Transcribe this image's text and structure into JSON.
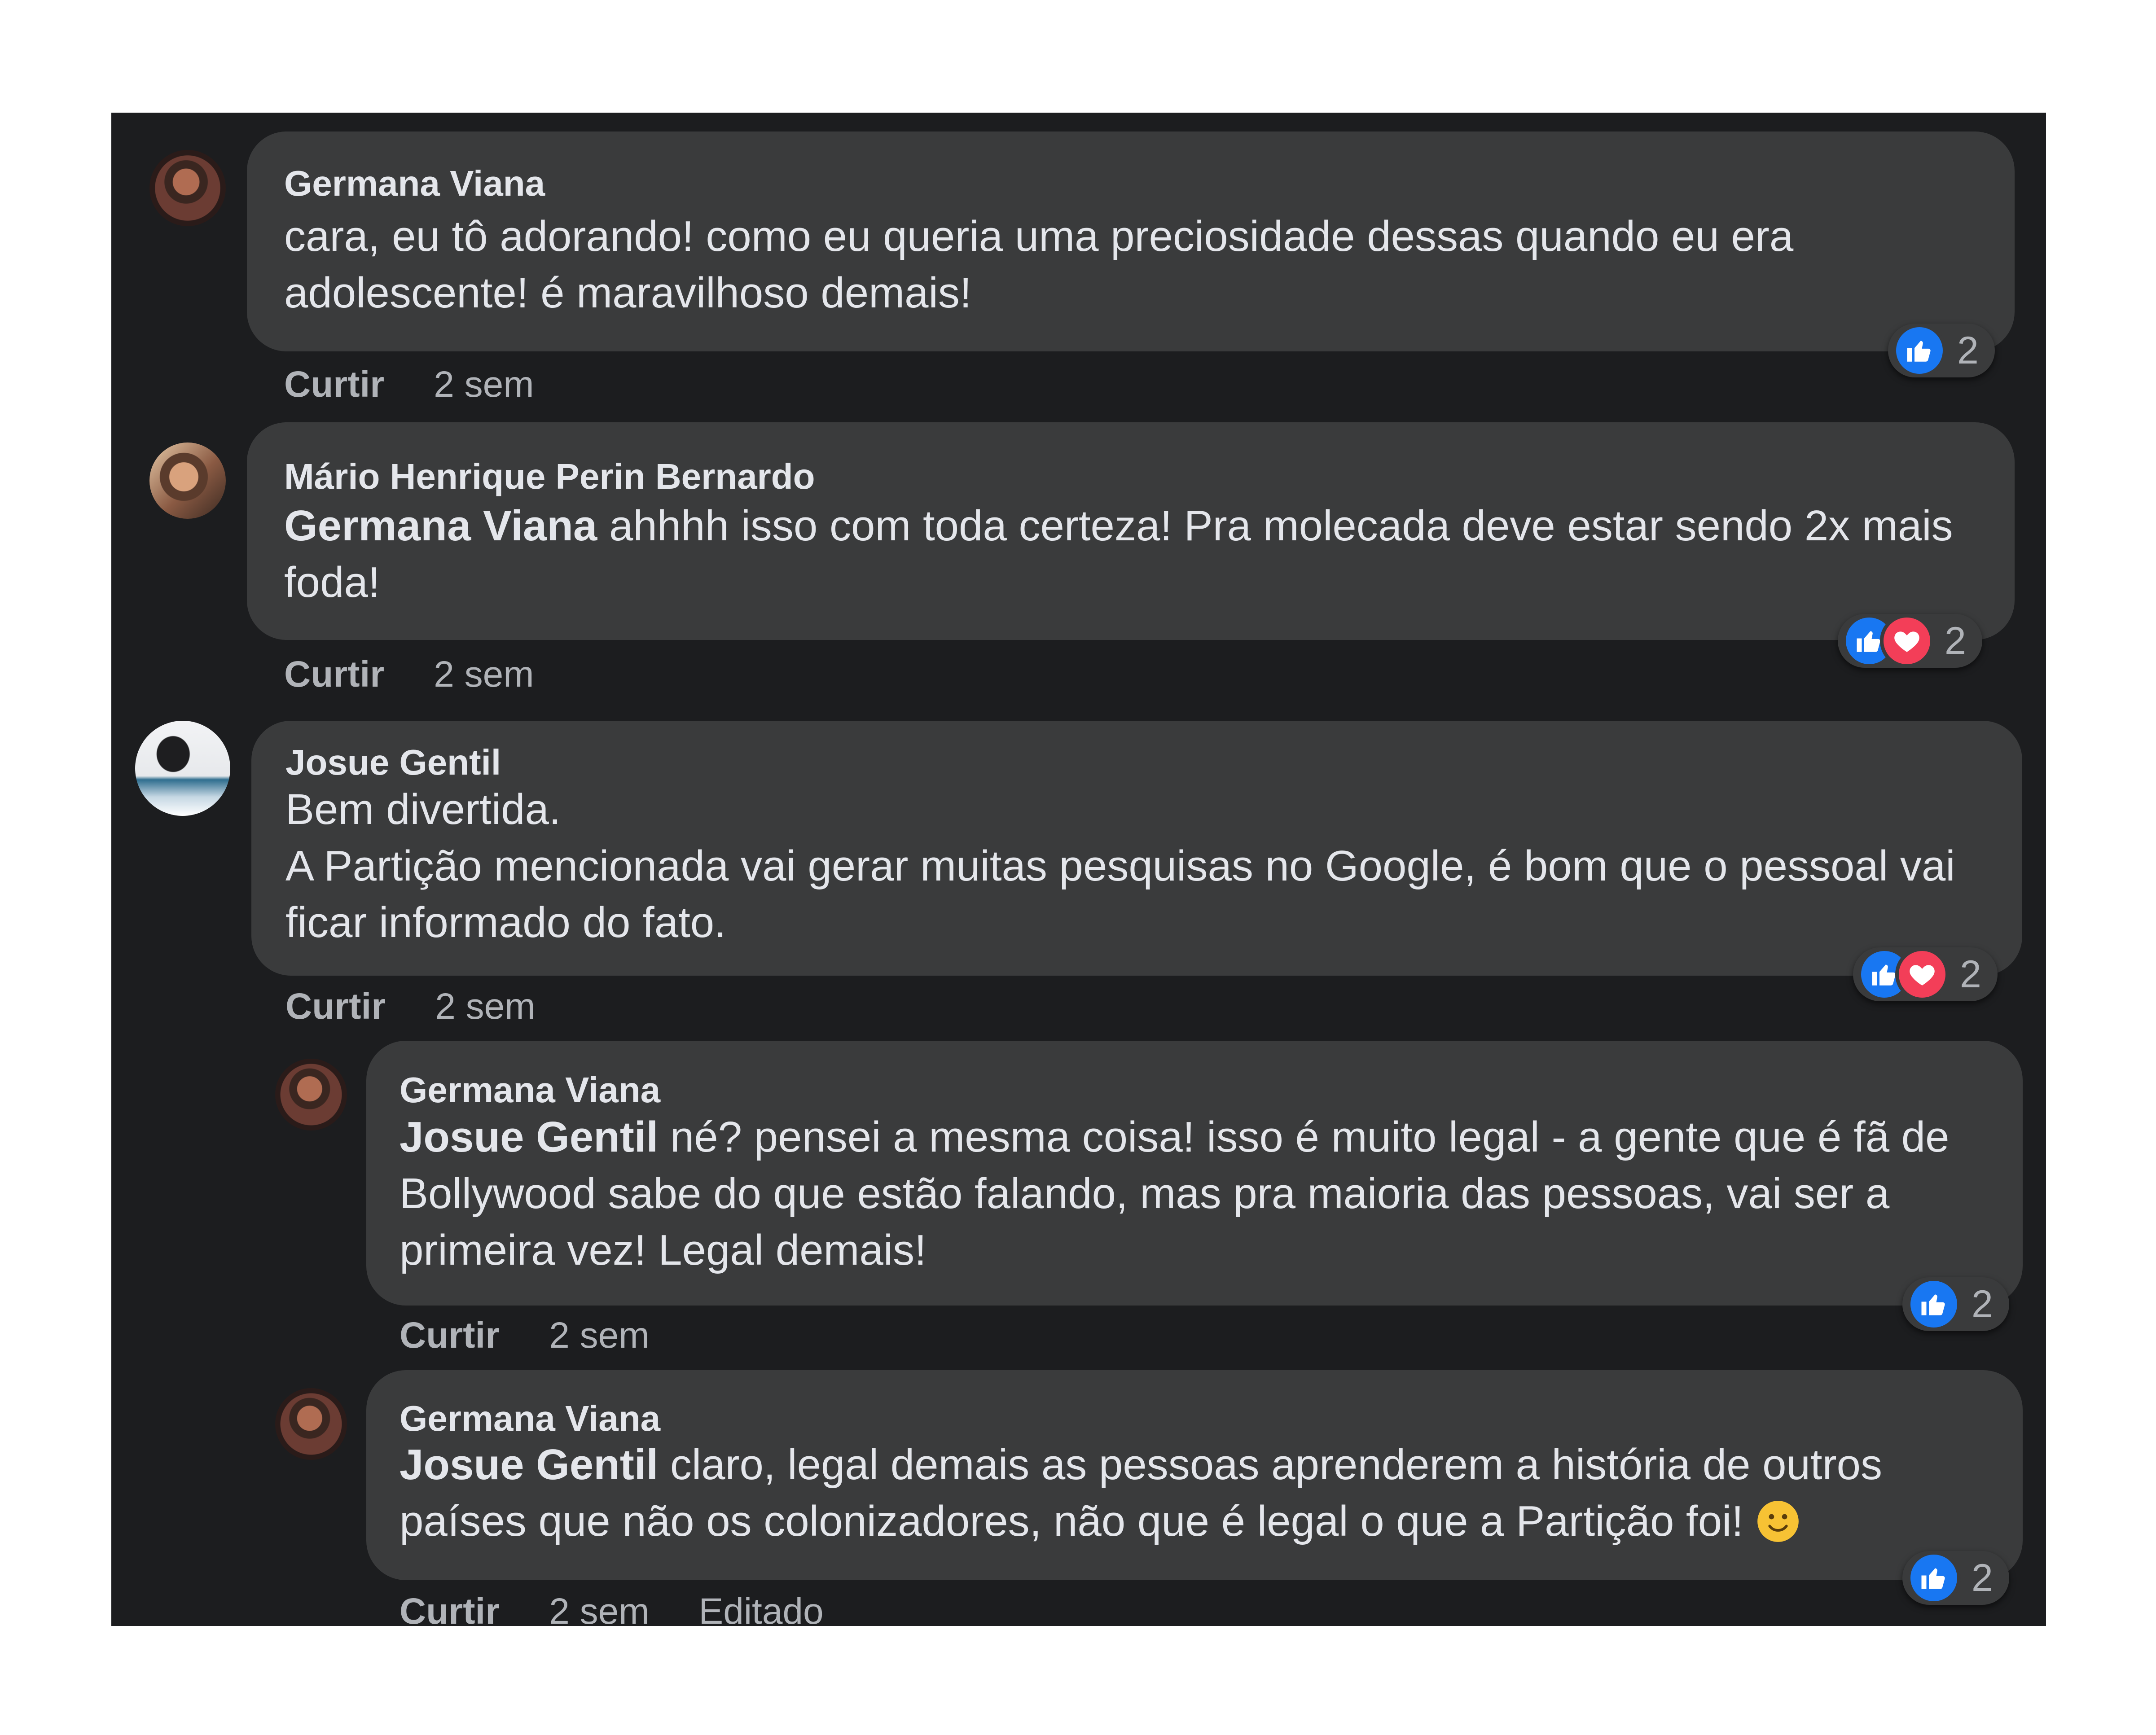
{
  "comments": [
    {
      "author": "Germana Viana",
      "text": "cara, eu tô adorando! como eu queria uma preciosidade dessas quando eu era adolescente! é maravilhoso demais!",
      "like_label": "Curtir",
      "time": "2 sem",
      "reactions": [
        "like-icon"
      ],
      "reaction_count": "2"
    },
    {
      "author": "Mário Henrique Perin Bernardo",
      "mention": "Germana Viana",
      "text": " ahhhh isso com toda certeza! Pra molecada deve estar sendo 2x mais foda!",
      "like_label": "Curtir",
      "time": "2 sem",
      "reactions": [
        "like-icon",
        "love-icon"
      ],
      "reaction_count": "2"
    },
    {
      "author": "Josue Gentil",
      "text_line1": "Bem divertida.",
      "text_line2": "A Partição mencionada vai gerar muitas pesquisas no Google, é bom que o pessoal vai ficar informado do fato.",
      "like_label": "Curtir",
      "time": "2 sem",
      "reactions": [
        "like-icon",
        "love-icon"
      ],
      "reaction_count": "2"
    },
    {
      "author": "Germana Viana",
      "mention": "Josue Gentil",
      "text": " né? pensei a mesma coisa! isso é muito legal - a gente que é fã de Bollywood sabe do que estão falando, mas pra maioria das pessoas, vai ser a primeira vez! Legal demais!",
      "like_label": "Curtir",
      "time": "2 sem",
      "reactions": [
        "like-icon"
      ],
      "reaction_count": "2"
    },
    {
      "author": "Germana Viana",
      "mention": "Josue Gentil",
      "text": " claro, legal demais as pessoas aprenderem a história de outros países que não os colonizadores, não que é legal o que a Partição foi! ",
      "emoji": "slightly-smiling-face-icon",
      "like_label": "Curtir",
      "time": "2 sem",
      "edited_label": "Editado",
      "reactions": [
        "like-icon"
      ],
      "reaction_count": "2"
    }
  ],
  "colors": {
    "background": "#1c1d1f",
    "bubble": "#3a3b3c",
    "text": "#e4e6eb",
    "secondary_text": "#b0b3b8",
    "like_blue": "#1877f2",
    "love_red": "#f33e58"
  }
}
